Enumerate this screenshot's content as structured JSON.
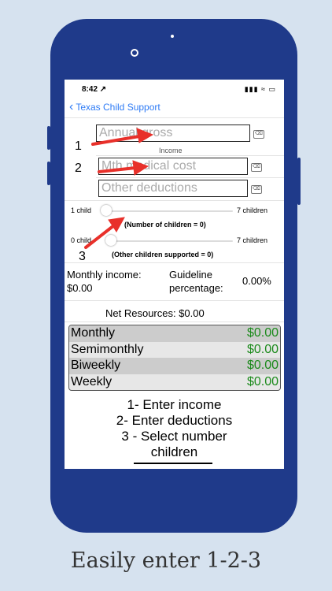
{
  "status_bar": {
    "time": "8:42 ↗",
    "indicators": "▮▮▮ ≈ ▭"
  },
  "nav": {
    "back_label": "Texas Child Support"
  },
  "form": {
    "annual_gross_placeholder": "Annual gross",
    "income_caption": "Income",
    "medical_placeholder": "Mth medical cost",
    "other_deductions_placeholder": "Other deductions",
    "clear_glyph": "⌫"
  },
  "children_slider": {
    "min_label": "1 child",
    "max_label": "7 children",
    "caption": "(Number of children = 0)",
    "value": 0
  },
  "other_slider": {
    "min_label": "0 child",
    "max_label": "7 children",
    "caption": "(Other children supported = 0)",
    "value": 0
  },
  "summary": {
    "monthly_income_label": "Monthly income:",
    "monthly_income_value": "$0.00",
    "guideline_label_1": "Guideline",
    "guideline_label_2": "percentage:",
    "guideline_value": "0.00%",
    "net_resources": "Net Resources:  $0.00"
  },
  "payments": [
    {
      "period": "Monthly",
      "amount": "$0.00"
    },
    {
      "period": "Semimonthly",
      "amount": "$0.00"
    },
    {
      "period": "Biweekly",
      "amount": "$0.00"
    },
    {
      "period": "Weekly",
      "amount": "$0.00"
    }
  ],
  "instructions": {
    "line1": "1- Enter income",
    "line2": "2- Enter deductions",
    "line3": "3 - Select number",
    "line4": "children"
  },
  "annotations": {
    "one": "1",
    "two": "2",
    "three": "3"
  },
  "colors": {
    "phone": "#1f3a8a",
    "background": "#d6e2ef",
    "accent": "#2e7bf5",
    "amount": "#1b8a1b",
    "arrow": "#e8302a"
  },
  "caption": "Easily enter 1-2-3"
}
